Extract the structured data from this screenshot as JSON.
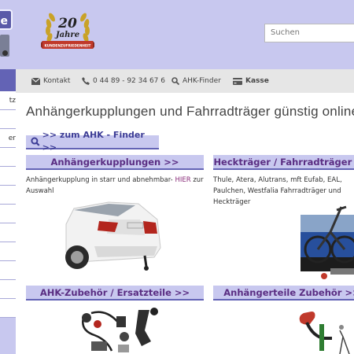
{
  "header": {
    "cut_button_label": "e",
    "badge": {
      "number": "20",
      "word": "Jahre",
      "ribbon": "KUNDENZUFRIEDENHEIT"
    },
    "search": {
      "placeholder": "Suchen"
    }
  },
  "sidebar": {
    "items": [
      "",
      "tz",
      "",
      "er",
      "",
      "",
      "",
      "",
      "",
      "",
      "",
      "",
      ""
    ]
  },
  "topbar": {
    "contact_label": "Kontakt",
    "phone_label": "0 44 89 - 92 34 67 6",
    "finder_label": "AHK-Finder",
    "cart_label": "Kasse"
  },
  "main": {
    "title": "Anhängerkupplungen und Fahrradträger günstig online",
    "finder_button": ">> zum AHK - Finder >>",
    "categories": [
      {
        "heading": "Anhängerkupplungen >>",
        "desc_before": "Anhängerkupplung in starr und abnehmbar- ",
        "desc_link": "HIER",
        "desc_after": " zur Auswahl",
        "image_icon": "car-with-towbar-image"
      },
      {
        "heading": "Heckträger / Fahrradträger >>",
        "desc_before": "Thule, Atera, Alutrans, mft Eufab, EAL, Paulchen, Westfalia Fahrradträger und Heckträger",
        "desc_link": "",
        "desc_after": "",
        "image_icon": "bike-carrier-image"
      },
      {
        "heading": "AHK-Zubehör / Ersatzteile >>",
        "image_icon": "wiring-harness-image"
      },
      {
        "heading": "Anhängerteile Zubehör >>",
        "image_icon": "trailer-light-image"
      }
    ]
  },
  "colors": {
    "lavender": "#c8c8ef",
    "accent": "#6363b5",
    "heading_text": "#5a2d82"
  }
}
